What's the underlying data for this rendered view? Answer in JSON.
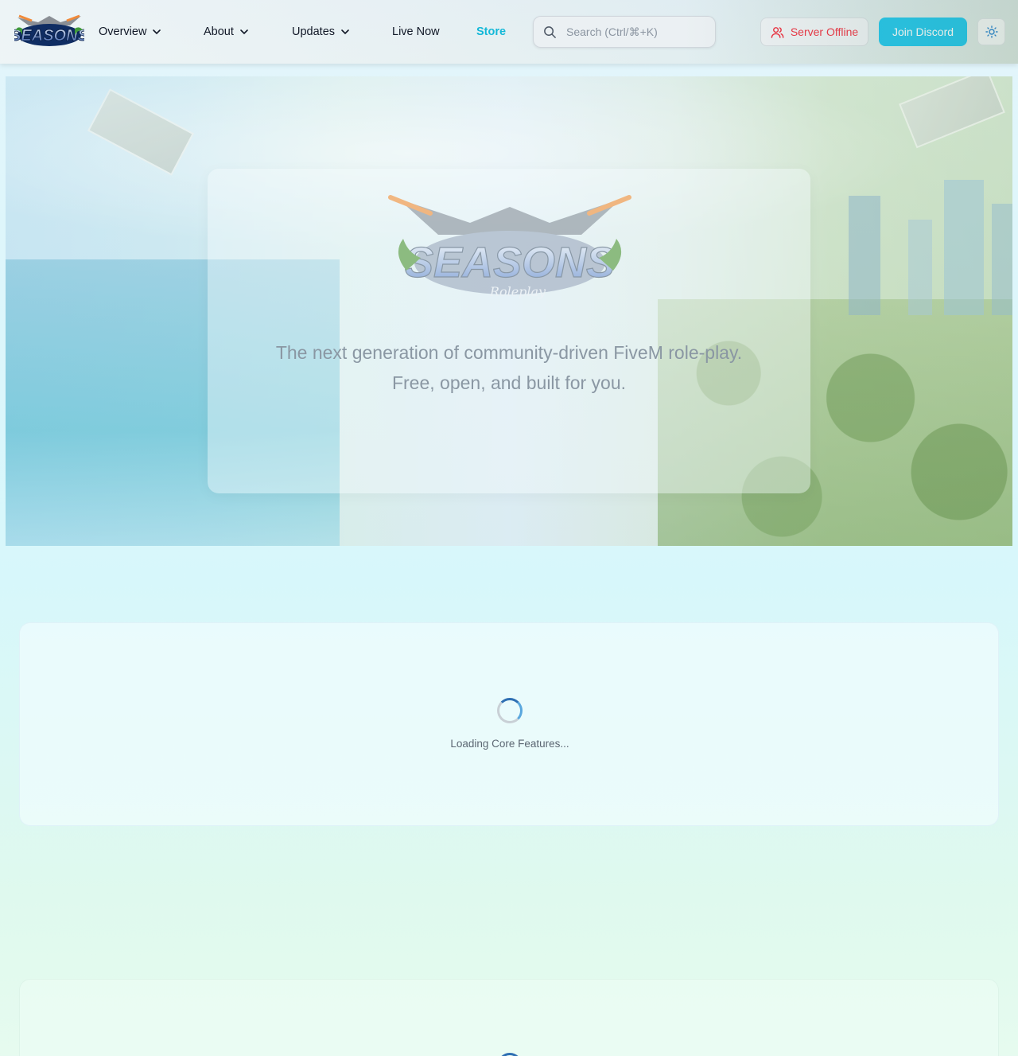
{
  "header": {
    "brand": "SEASONS",
    "nav": [
      {
        "label": "Overview",
        "has_dropdown": true
      },
      {
        "label": "About",
        "has_dropdown": true
      },
      {
        "label": "Updates",
        "has_dropdown": true
      },
      {
        "label": "Live Now",
        "has_dropdown": false
      },
      {
        "label": "Store",
        "has_dropdown": false
      }
    ],
    "search": {
      "placeholder": "Search (Ctrl/⌘+K)",
      "value": ""
    },
    "server_status": {
      "label": "Server Offline",
      "color": "#ef2b3c"
    },
    "discord_button": {
      "label": "Join Discord",
      "color": "#13c3ec"
    },
    "theme_toggle": {
      "icon": "sun-icon"
    }
  },
  "hero": {
    "logo_text": "SEASONS",
    "logo_subtext": "Roleplay",
    "tagline_line1": "The next generation of community-driven FiveM role-play.",
    "tagline_line2": "Free, open, and built for you."
  },
  "sections": {
    "core_features": {
      "loading_text": "Loading Core Features..."
    }
  },
  "colors": {
    "accent": "#13b8d8",
    "status_offline": "#ef2b3c",
    "text_primary": "#111827"
  }
}
